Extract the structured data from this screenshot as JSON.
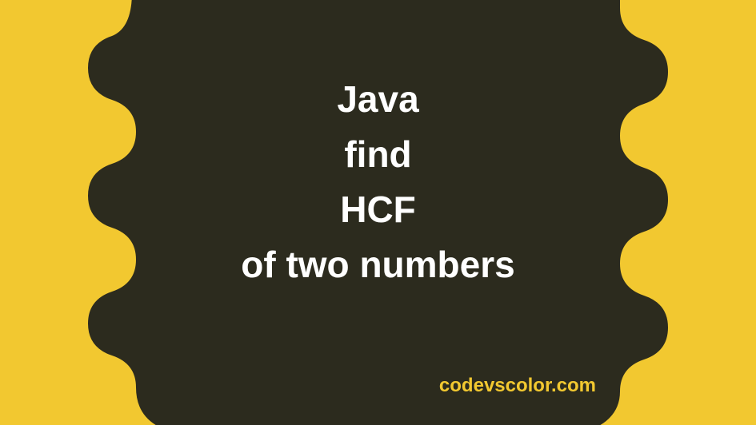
{
  "title": {
    "line1": "Java",
    "line2": "find",
    "line3": "HCF",
    "line4": "of two numbers"
  },
  "website": "codevscolor.com",
  "colors": {
    "background": "#f2c830",
    "blob": "#2c2b1e",
    "text_main": "#ffffff",
    "text_website": "#f2c830"
  }
}
